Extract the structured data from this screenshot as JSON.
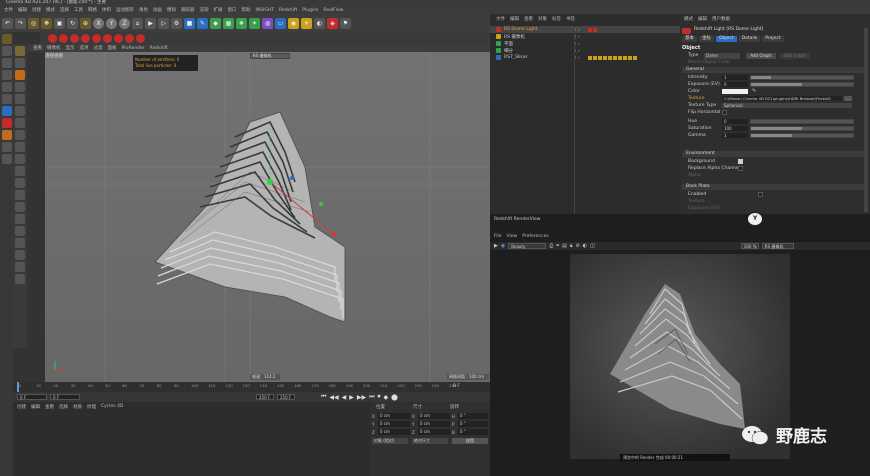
{
  "window_title": "Cinema 4D R21.207 (RC) - [鹿鹿.c4d *] - 主要",
  "menu": [
    "文件",
    "编辑",
    "创建",
    "模式",
    "选择",
    "工具",
    "网格",
    "体积",
    "运动图形",
    "角色",
    "动画",
    "模拟",
    "跟踪器",
    "渲染",
    "扩展",
    "窗口",
    "帮助",
    "INSIGHT",
    "Redshift",
    "Plugins",
    "RealFlow"
  ],
  "viewport": {
    "menu": [
      "查看",
      "摄像机",
      "显示",
      "选项",
      "过滤",
      "面板",
      "ProRender",
      "Redshift"
    ],
    "label": "透视视图",
    "camera_dropdown": "RS 摄像机",
    "stats": [
      "Number of emitters: 0",
      "Total live particles: 0"
    ],
    "frame_label": "帧速：114.2",
    "grid_label": "网格间距：100 cm"
  },
  "timeline": {
    "ticks": [
      "0",
      "10",
      "20",
      "30",
      "40",
      "50",
      "60",
      "70",
      "80",
      "90",
      "100",
      "110",
      "120",
      "130",
      "140",
      "150",
      "160",
      "170",
      "180",
      "190",
      "200",
      "210",
      "220",
      "230",
      "240",
      "250"
    ],
    "current": "0 F",
    "start": "0 F",
    "end_a": "250 F",
    "end_b": "250 F",
    "frame_readout": "0 F"
  },
  "material_panel": {
    "menu": [
      "创建",
      "编辑",
      "查看",
      "选择",
      "材质",
      "纹理",
      "Cycles 4D"
    ]
  },
  "coords": {
    "headers": [
      "位置",
      "尺寸",
      "旋转"
    ],
    "rows": [
      {
        "axis": "X",
        "pos": "0 cm",
        "size": "0 cm",
        "rot_axis": "H",
        "rot": "0 °"
      },
      {
        "axis": "Y",
        "pos": "0 cm",
        "size": "0 cm",
        "rot_axis": "P",
        "rot": "0 °"
      },
      {
        "axis": "Z",
        "pos": "0 cm",
        "size": "0 cm",
        "rot_axis": "B",
        "rot": "0 °"
      }
    ],
    "mode": "对象 (相对)",
    "size_mode": "绝对尺寸",
    "apply": "应用"
  },
  "object_manager": {
    "menu": [
      "文件",
      "编辑",
      "查看",
      "对象",
      "标签",
      "书签"
    ],
    "items": [
      {
        "name": "RS Dome Light",
        "selected": true
      },
      {
        "name": "RS 摄像机",
        "selected": false
      },
      {
        "name": "平面",
        "selected": false
      },
      {
        "name": "细分",
        "selected": false
      },
      {
        "name": "RS7_Slicer",
        "selected": false
      }
    ]
  },
  "attributes": {
    "menu": [
      "模式",
      "编辑",
      "用户数据"
    ],
    "title": "Redshift Light [RS Dome Light]",
    "tabs": [
      "基本",
      "坐标",
      "Object",
      "Details",
      "Project"
    ],
    "section_object": "Object",
    "type_label": "Type",
    "type_value": "Dome",
    "add_graph": "Add Graph",
    "edit_graph": "Edit Graph",
    "blend_label": "Blend Object Color",
    "section_general": "General",
    "intensity_label": "Intensity",
    "intensity_value": "1",
    "exposure_label": "Exposure (EV)",
    "exposure_value": "0",
    "color_label": "Color",
    "texture_label": "Texture",
    "texture_value": "C:\\Maxon Cinema 4D R21\\plugins\\HDRI Browser\\Packs\\S",
    "texture_type_label": "Texture Type",
    "texture_type_value": "Spherical",
    "flip_label": "Flip Horizontal",
    "hue_label": "Hue",
    "hue_value": "0",
    "saturation_label": "Saturation",
    "saturation_value": "100",
    "gamma_label": "Gamma",
    "gamma_value": "1",
    "section_environment": "Environment",
    "background_label": "Background",
    "replace_alpha_label": "Replace Alpha Channel",
    "alpha_label": "Alpha",
    "section_backplate": "Back Plate",
    "enabled_label": "Enabled",
    "bp_texture_label": "Texture",
    "bp_exposure_label": "Exposure (EV)"
  },
  "renderview": {
    "title": "Redshift RenderView",
    "menu": [
      "File",
      "View",
      "Preferences"
    ],
    "mode": "Beauty",
    "zoom": "100 %",
    "camera": "RS 摄像机",
    "status_bar": "预览中的 Render 完成 00:00:21"
  },
  "watermark": {
    "text": "野鹿志"
  }
}
